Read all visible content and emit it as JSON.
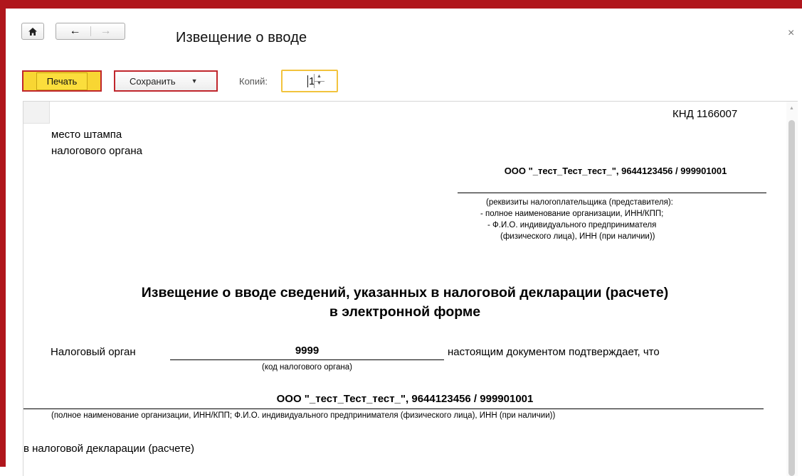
{
  "window": {
    "title": "Извещение о вводе",
    "close_symbol": "×"
  },
  "nav": {
    "home_icon": "⌂",
    "back_icon": "←",
    "forward_icon": "→"
  },
  "toolbar": {
    "print_label": "Печать",
    "save_label": "Сохранить",
    "save_caret": "▼",
    "copies_label": "Копий:",
    "copies_value": "1"
  },
  "document": {
    "knd": "КНД 1166007",
    "stamp_line1": "место штампа",
    "stamp_line2": "налогового органа",
    "org_top": "ООО \"_тест_Тест_тест_\", 9644123456 / 999901001",
    "requisites": [
      "(реквизиты налогоплательщика (представителя):",
      "- полное наименование организации, ИНН/КПП;",
      "- Ф.И.О. индивидуального предпринимателя",
      "(физического лица), ИНН (при наличии))"
    ],
    "heading_line1": "Извещение о вводе сведений, указанных в налоговой декларации (расчете)",
    "heading_line2": "в электронной форме",
    "tax_authority_label": "Налоговый орган",
    "tax_authority_code": "9999",
    "tax_authority_after": "настоящим документом подтверждает, что",
    "code_note": "(код налогового органа)",
    "org_mid": "ООО \"_тест_Тест_тест_\", 9644123456 / 999901001",
    "full_note": "(полное наименование организации, ИНН/КПП; Ф.И.О. индивидуального предпринимателя (физического лица), ИНН (при наличии))",
    "declaration_text": "в налоговой декларации (расчете)"
  },
  "colors": {
    "frame": "#b0161c",
    "print_button": "#f8d633",
    "highlight_border": "#c0262c",
    "copies_border": "#f2c33d"
  }
}
